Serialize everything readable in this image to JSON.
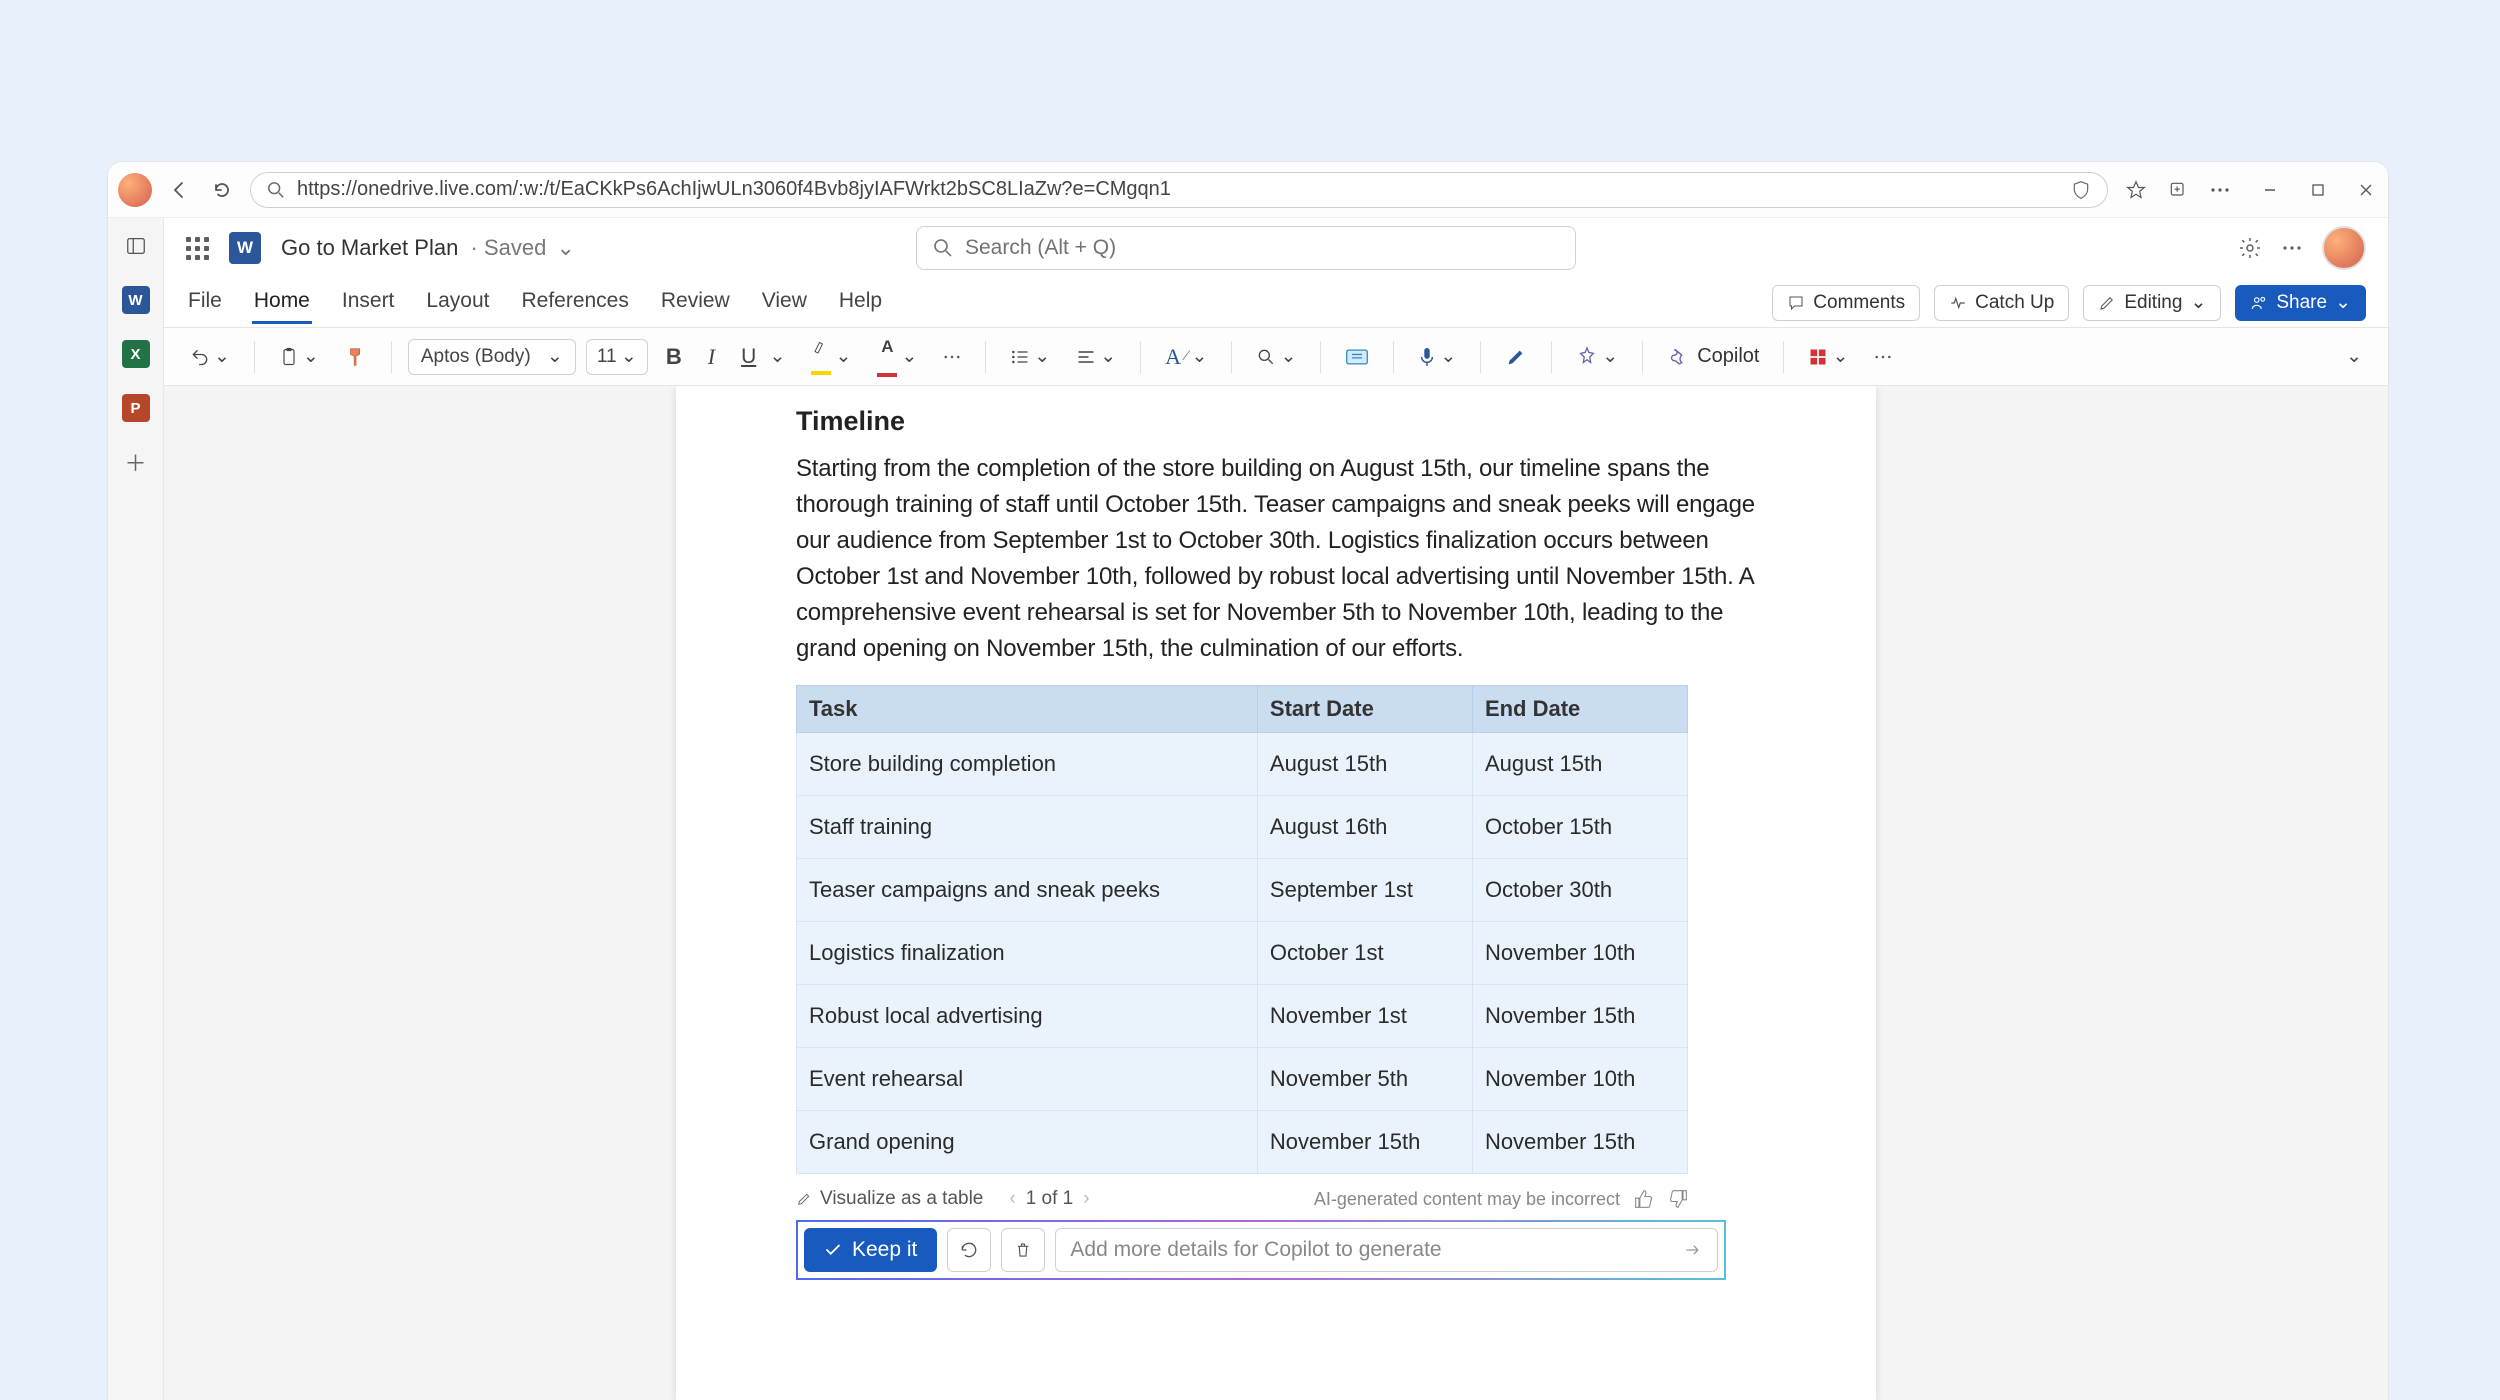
{
  "browser": {
    "url": "https://onedrive.live.com/:w:/t/EaCKkPs6AchIjwULn3060f4Bvb8jyIAFWrkt2bSC8LIaZw?e=CMgqn1"
  },
  "rail": {
    "apps": [
      "W",
      "X",
      "P"
    ]
  },
  "header": {
    "doc_name": "Go to Market Plan",
    "status": "Saved",
    "search_placeholder": "Search (Alt + Q)"
  },
  "tabs": {
    "items": [
      "File",
      "Home",
      "Insert",
      "Layout",
      "References",
      "Review",
      "View",
      "Help"
    ],
    "active": "Home",
    "right": {
      "comments": "Comments",
      "catchup": "Catch Up",
      "editing": "Editing",
      "share": "Share"
    }
  },
  "ribbon": {
    "font": "Aptos (Body)",
    "size": "11",
    "copilot": "Copilot"
  },
  "document": {
    "heading": "Timeline",
    "paragraph": "Starting from the completion of the store building on August 15th, our timeline spans the thorough training of staff until October 15th. Teaser campaigns and sneak peeks will engage our audience from September 1st to October 30th. Logistics finalization occurs between October 1st and November 10th, followed by robust local advertising until November 15th. A comprehensive event rehearsal is set for November 5th to November 10th, leading to the grand opening on November 15th, the culmination of our efforts.",
    "table": {
      "headers": [
        "Task",
        "Start Date",
        "End Date"
      ],
      "rows": [
        [
          "Store building completion",
          "August 15th",
          "August 15th"
        ],
        [
          "Staff training",
          "August 16th",
          "October 15th"
        ],
        [
          "Teaser campaigns and sneak peeks",
          "September 1st",
          "October 30th"
        ],
        [
          "Logistics finalization",
          "October 1st",
          "November 10th"
        ],
        [
          "Robust local advertising",
          "November 1st",
          "November 15th"
        ],
        [
          "Event rehearsal",
          "November 5th",
          "November 10th"
        ],
        [
          "Grand opening",
          "November 15th",
          "November 15th"
        ]
      ]
    }
  },
  "copilot": {
    "prompt_label": "Visualize as a table",
    "pager": "1 of 1",
    "disclaimer": "AI-generated content may be incorrect",
    "keep": "Keep it",
    "input_placeholder": "Add more details for Copilot to generate"
  }
}
